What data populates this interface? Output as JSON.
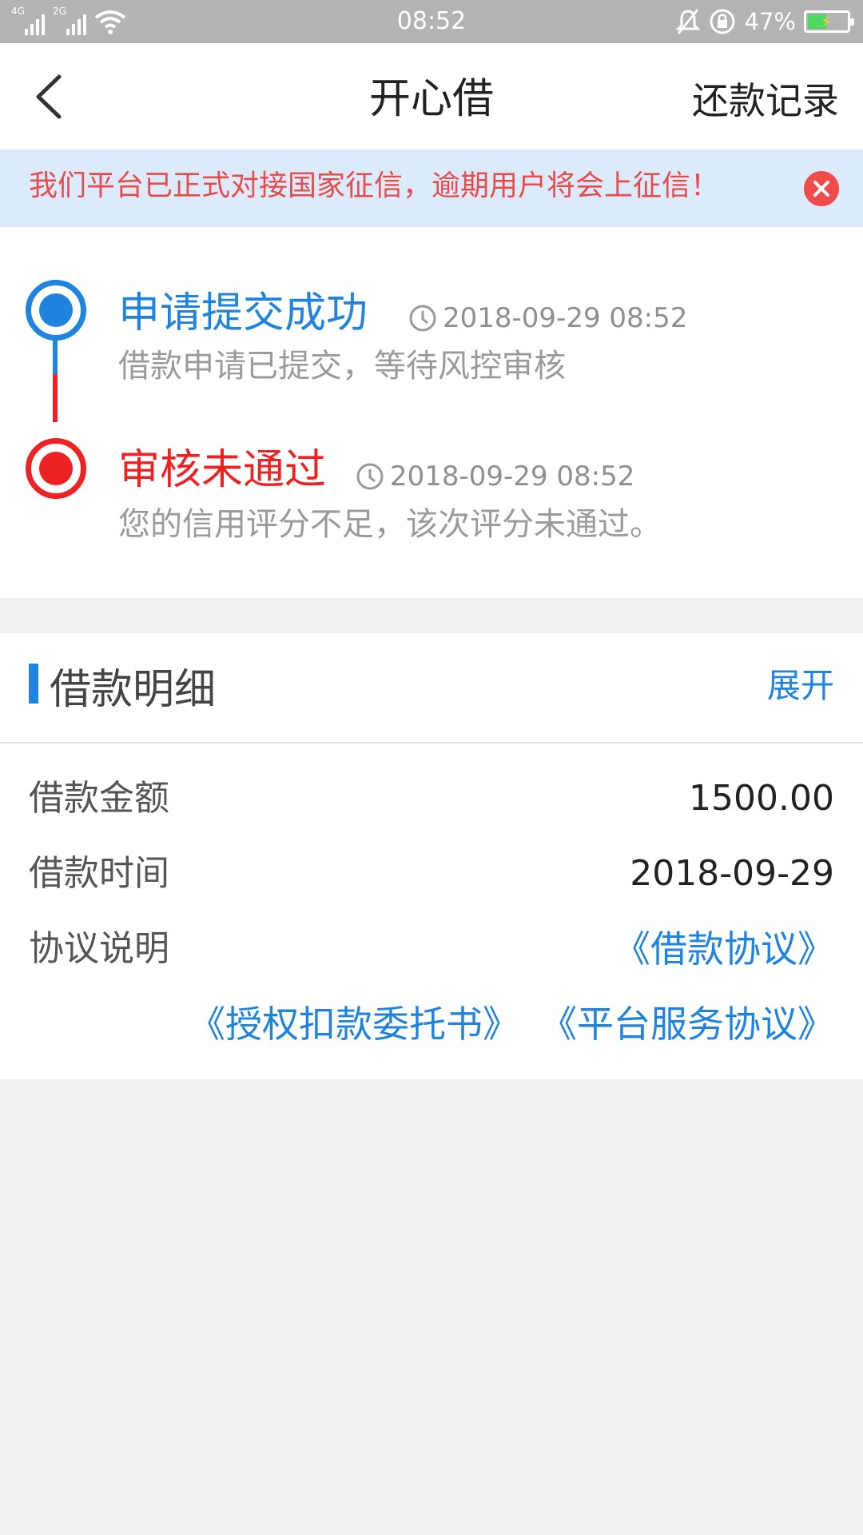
{
  "status_bar": {
    "signal1_label": "4G",
    "signal2_label": "2G",
    "time": "08:52",
    "battery_percent": "47%",
    "battery_level": 0.47
  },
  "nav": {
    "back_icon": "chevron-left-icon",
    "title": "开心借",
    "right_action": "还款记录"
  },
  "notice": {
    "text": "我们平台已正式对接国家征信，逾期用户将会上征信！",
    "close_icon": "close-circle-icon"
  },
  "timeline": [
    {
      "title": "申请提交成功",
      "time": "2018-09-29 08:52",
      "desc": "借款申请已提交，等待风控审核",
      "color": "#1f83e0"
    },
    {
      "title": "审核未通过",
      "time": "2018-09-29 08:52",
      "desc": "您的信用评分不足，该次评分未通过。",
      "color": "#ee2222"
    }
  ],
  "detail": {
    "title": "借款明细",
    "expand": "展开",
    "rows": [
      {
        "label": "借款金额",
        "value": "1500.00"
      },
      {
        "label": "借款时间",
        "value": "2018-09-29"
      },
      {
        "label": "协议说明",
        "value": ""
      }
    ],
    "agreements": [
      "《借款协议》",
      "《授权扣款委托书》",
      "《平台服务协议》"
    ]
  },
  "colors": {
    "accent": "#1f83e0",
    "error": "#ee2222",
    "notice_bg": "#dcebfb",
    "notice_text": "#e94b4b",
    "page_bg": "#f0f0f0"
  }
}
